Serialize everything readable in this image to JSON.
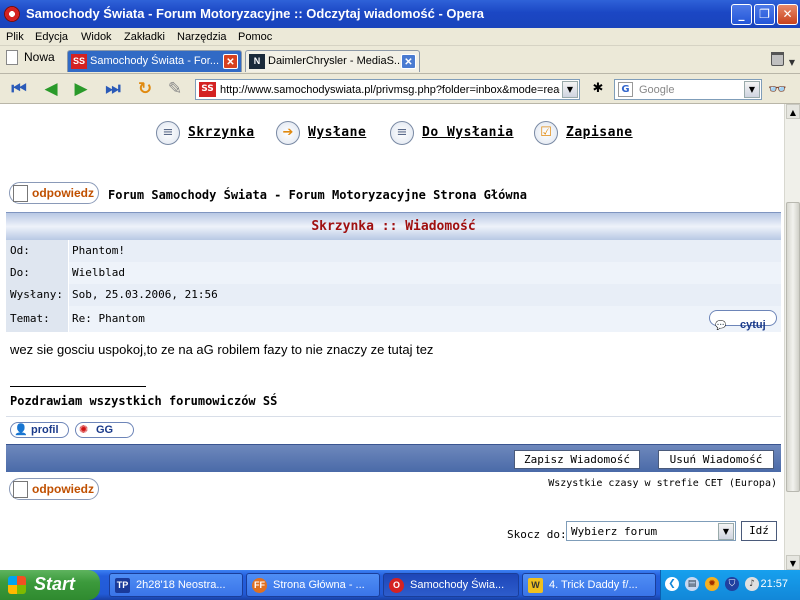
{
  "window": {
    "title": "Samochody Świata - Forum Motoryzacyjne :: Odczytaj wiadomość - Opera"
  },
  "menu": [
    "Plik",
    "Edycja",
    "Widok",
    "Zakładki",
    "Narzędzia",
    "Pomoc"
  ],
  "tabs": {
    "new_label": "Nowa",
    "items": [
      {
        "label": "Samochody Świata - For...",
        "favicon": "SS",
        "active": true
      },
      {
        "label": "DaimlerChrysler - MediaS...",
        "favicon": "N",
        "active": false
      }
    ]
  },
  "address": {
    "url": "http://www.samochodyswiata.pl/privmsg.php?folder=inbox&mode=read",
    "favicon": "SS",
    "search_placeholder": "Google"
  },
  "forum": {
    "nav": [
      "Skrzynka",
      "Wysłane",
      "Do Wysłania",
      "Zapisane"
    ],
    "reply_label": "odpowiedz",
    "breadcrumb": "Forum Samochody Świata - Forum Motoryzacyjne Strona Główna",
    "header": "Skrzynka :: Wiadomość",
    "fields": [
      {
        "label": "Od:",
        "value": "Phantom!"
      },
      {
        "label": "Do:",
        "value": "Wielblad"
      },
      {
        "label": "Wysłany:",
        "value": "Sob, 25.03.2006, 21:56"
      },
      {
        "label": "Temat:",
        "value": "Re: Phantom"
      }
    ],
    "quote_label": "cytuj",
    "body": "wez sie gosciu uspokoj,to ze na aG robilem fazy to nie znaczy ze tutaj tez",
    "signature": "Pozdrawiam wszystkich forumowiczów SŚ",
    "profile_label": "profil",
    "gg_label": "GG",
    "save_label": "Zapisz Wiadomość",
    "delete_label": "Usuń Wiadomość",
    "timezone": "Wszystkie czasy w strefie CET (Europa)",
    "jump_label": "Skocz do:",
    "jump_value": "Wybierz forum",
    "go_label": "Idź"
  },
  "taskbar": {
    "start": "Start",
    "tasks": [
      {
        "label": "2h28'18 Neostra...",
        "icon": "TP",
        "active": false
      },
      {
        "label": "Strona Główna - ...",
        "icon": "FF",
        "active": false
      },
      {
        "label": "Samochody Świa...",
        "icon": "O",
        "active": true
      },
      {
        "label": "4. Trick Daddy f/...",
        "icon": "W",
        "active": false
      }
    ],
    "clock": "21:57"
  }
}
